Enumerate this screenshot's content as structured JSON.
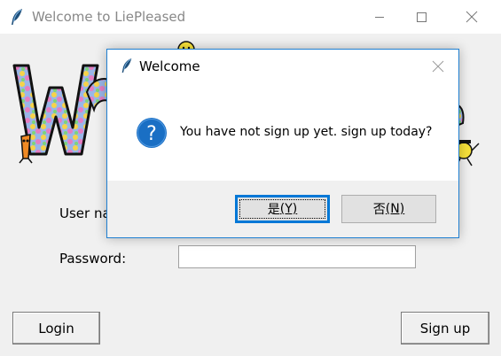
{
  "window": {
    "title": "Welcome to LiePleased",
    "icon": "feather-icon"
  },
  "form": {
    "username_label": "User name:",
    "password_label": "Password:",
    "username_value": "",
    "password_value": ""
  },
  "buttons": {
    "login": "Login",
    "signup": "Sign up"
  },
  "dialog": {
    "title": "Welcome",
    "icon": "question-icon",
    "message": "You have not sign up yet. sign up today?",
    "yes_label": "是",
    "yes_mnemonic": "(Y)",
    "no_label": "否",
    "no_mnemonic": "(N)"
  },
  "colors": {
    "dialog_border": "#1f7fd1",
    "question_icon": "#1a6fc4",
    "focus_border": "#0078d7"
  }
}
